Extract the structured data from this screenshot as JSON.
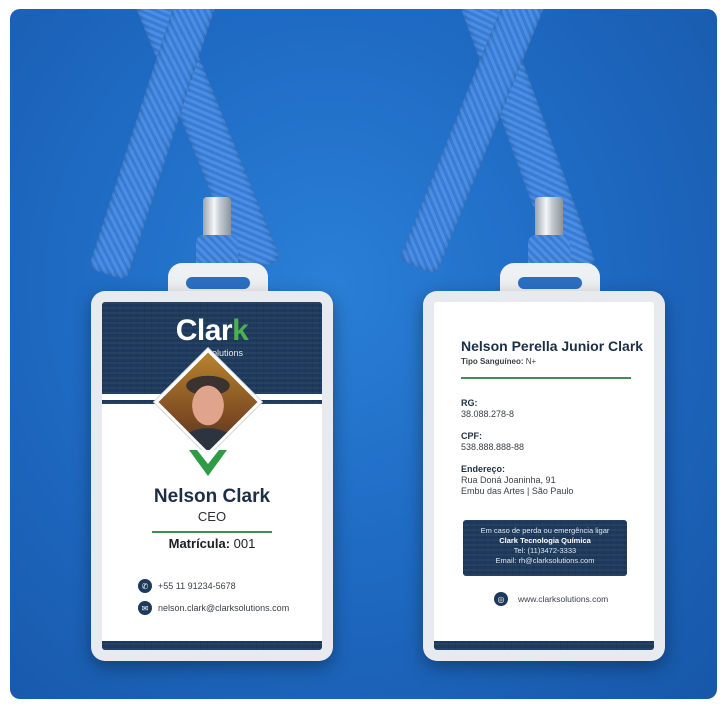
{
  "front": {
    "logo_main": "Clar",
    "logo_k": "k",
    "logo_sub": "Solutions",
    "name": "Nelson Clark",
    "role": "CEO",
    "matricula_label": "Matrícula:",
    "matricula_value": "001",
    "phone": "+55 11 91234-5678",
    "email": "nelson.clark@clarksolutions.com"
  },
  "back": {
    "full_name": "Nelson Perella Junior Clark",
    "blood_label": "Tipo Sanguíneo:",
    "blood_value": "N+",
    "rg_label": "RG:",
    "rg_value": "38.088.278-8",
    "cpf_label": "CPF:",
    "cpf_value": "538.888.888-88",
    "address_label": "Endereço:",
    "address_line1": "Rua Doná Joaninha, 91",
    "address_line2": "Embu das Artes | São Paulo",
    "emergency_line1": "Em caso de perda ou emergência ligar",
    "emergency_company": "Clark Tecnologia Química",
    "emergency_phone": "Tel: (11)3472-3333",
    "emergency_email": "Email: rh@clarksolutions.com",
    "website": "www.clarksolutions.com"
  },
  "colors": {
    "background": "#1f6bc4",
    "navy": "#1d3a5c",
    "green": "#2e9b47",
    "holder": "#e7eaee"
  },
  "icons": [
    "phone-icon",
    "email-icon",
    "globe-icon"
  ]
}
